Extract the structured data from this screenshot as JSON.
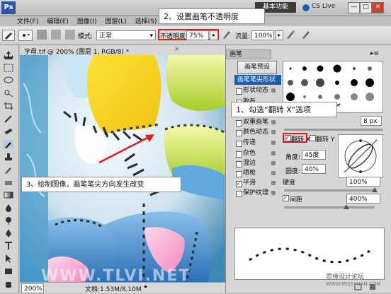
{
  "app": {
    "logo_text": "Ps",
    "workspace_label": "基本功能",
    "cslive_label": "CS Live",
    "window_buttons": [
      "—",
      "□",
      "✕"
    ]
  },
  "menu": {
    "items": [
      "文件(F)",
      "编辑(E)",
      "图像(I)",
      "图层(L)",
      "选择(S)"
    ]
  },
  "options": {
    "mode_label": "模式:",
    "mode_value": "正常",
    "opacity_label": "不透明度:",
    "opacity_value": "75%",
    "flow_label": "流量:",
    "flow_value": "100%"
  },
  "document": {
    "tab_title": "字母.tif @ 200% (图层 1, RGB/8) *",
    "zoom": "200%",
    "doc_size": "文档:1.53M/8.10M"
  },
  "panel": {
    "title": "画笔",
    "preset_button": "画笔预设",
    "items": [
      {
        "label": "画笔笔尖形状",
        "selected": true,
        "checked": false
      },
      {
        "label": "形状动态",
        "selected": false,
        "checked": false
      },
      {
        "label": "散布",
        "selected": false,
        "checked": false
      },
      {
        "label": "纹理",
        "selected": false,
        "checked": false
      },
      {
        "label": "双重画笔",
        "selected": false,
        "checked": false
      },
      {
        "label": "颜色动态",
        "selected": false,
        "checked": false
      },
      {
        "label": "传递",
        "selected": false,
        "checked": false
      },
      {
        "label": "杂色",
        "selected": false,
        "checked": false
      },
      {
        "label": "湿边",
        "selected": false,
        "checked": false
      },
      {
        "label": "喷枪",
        "selected": false,
        "checked": false
      },
      {
        "label": "平滑",
        "selected": false,
        "checked": true
      },
      {
        "label": "保护纹理",
        "selected": false,
        "checked": false
      }
    ],
    "size_value": "8 px",
    "flip_x_label": "翻转 X",
    "flip_y_label": "翻转 Y",
    "angle_label": "角度:",
    "angle_value": "45度",
    "roundness_label": "圆度:",
    "roundness_value": "40%",
    "hardness_label": "硬度",
    "hardness_value": "100%",
    "spacing_label": "间距",
    "spacing_value": "400%"
  },
  "annotations": {
    "step1": "1、勾选“翻转 X”选项",
    "step2": "2、设置画笔不透明度",
    "step3": "3、绘制图像，画笔笔尖方向发生改变"
  },
  "watermark": {
    "left": "WWW.TLVI.NET",
    "right_cn": "思缘设计论坛",
    "right_url": "WWW.MISSYUAN.COM"
  },
  "colors": {
    "highlight_red": "#e0201f",
    "selection_blue": "#1b5fae"
  }
}
